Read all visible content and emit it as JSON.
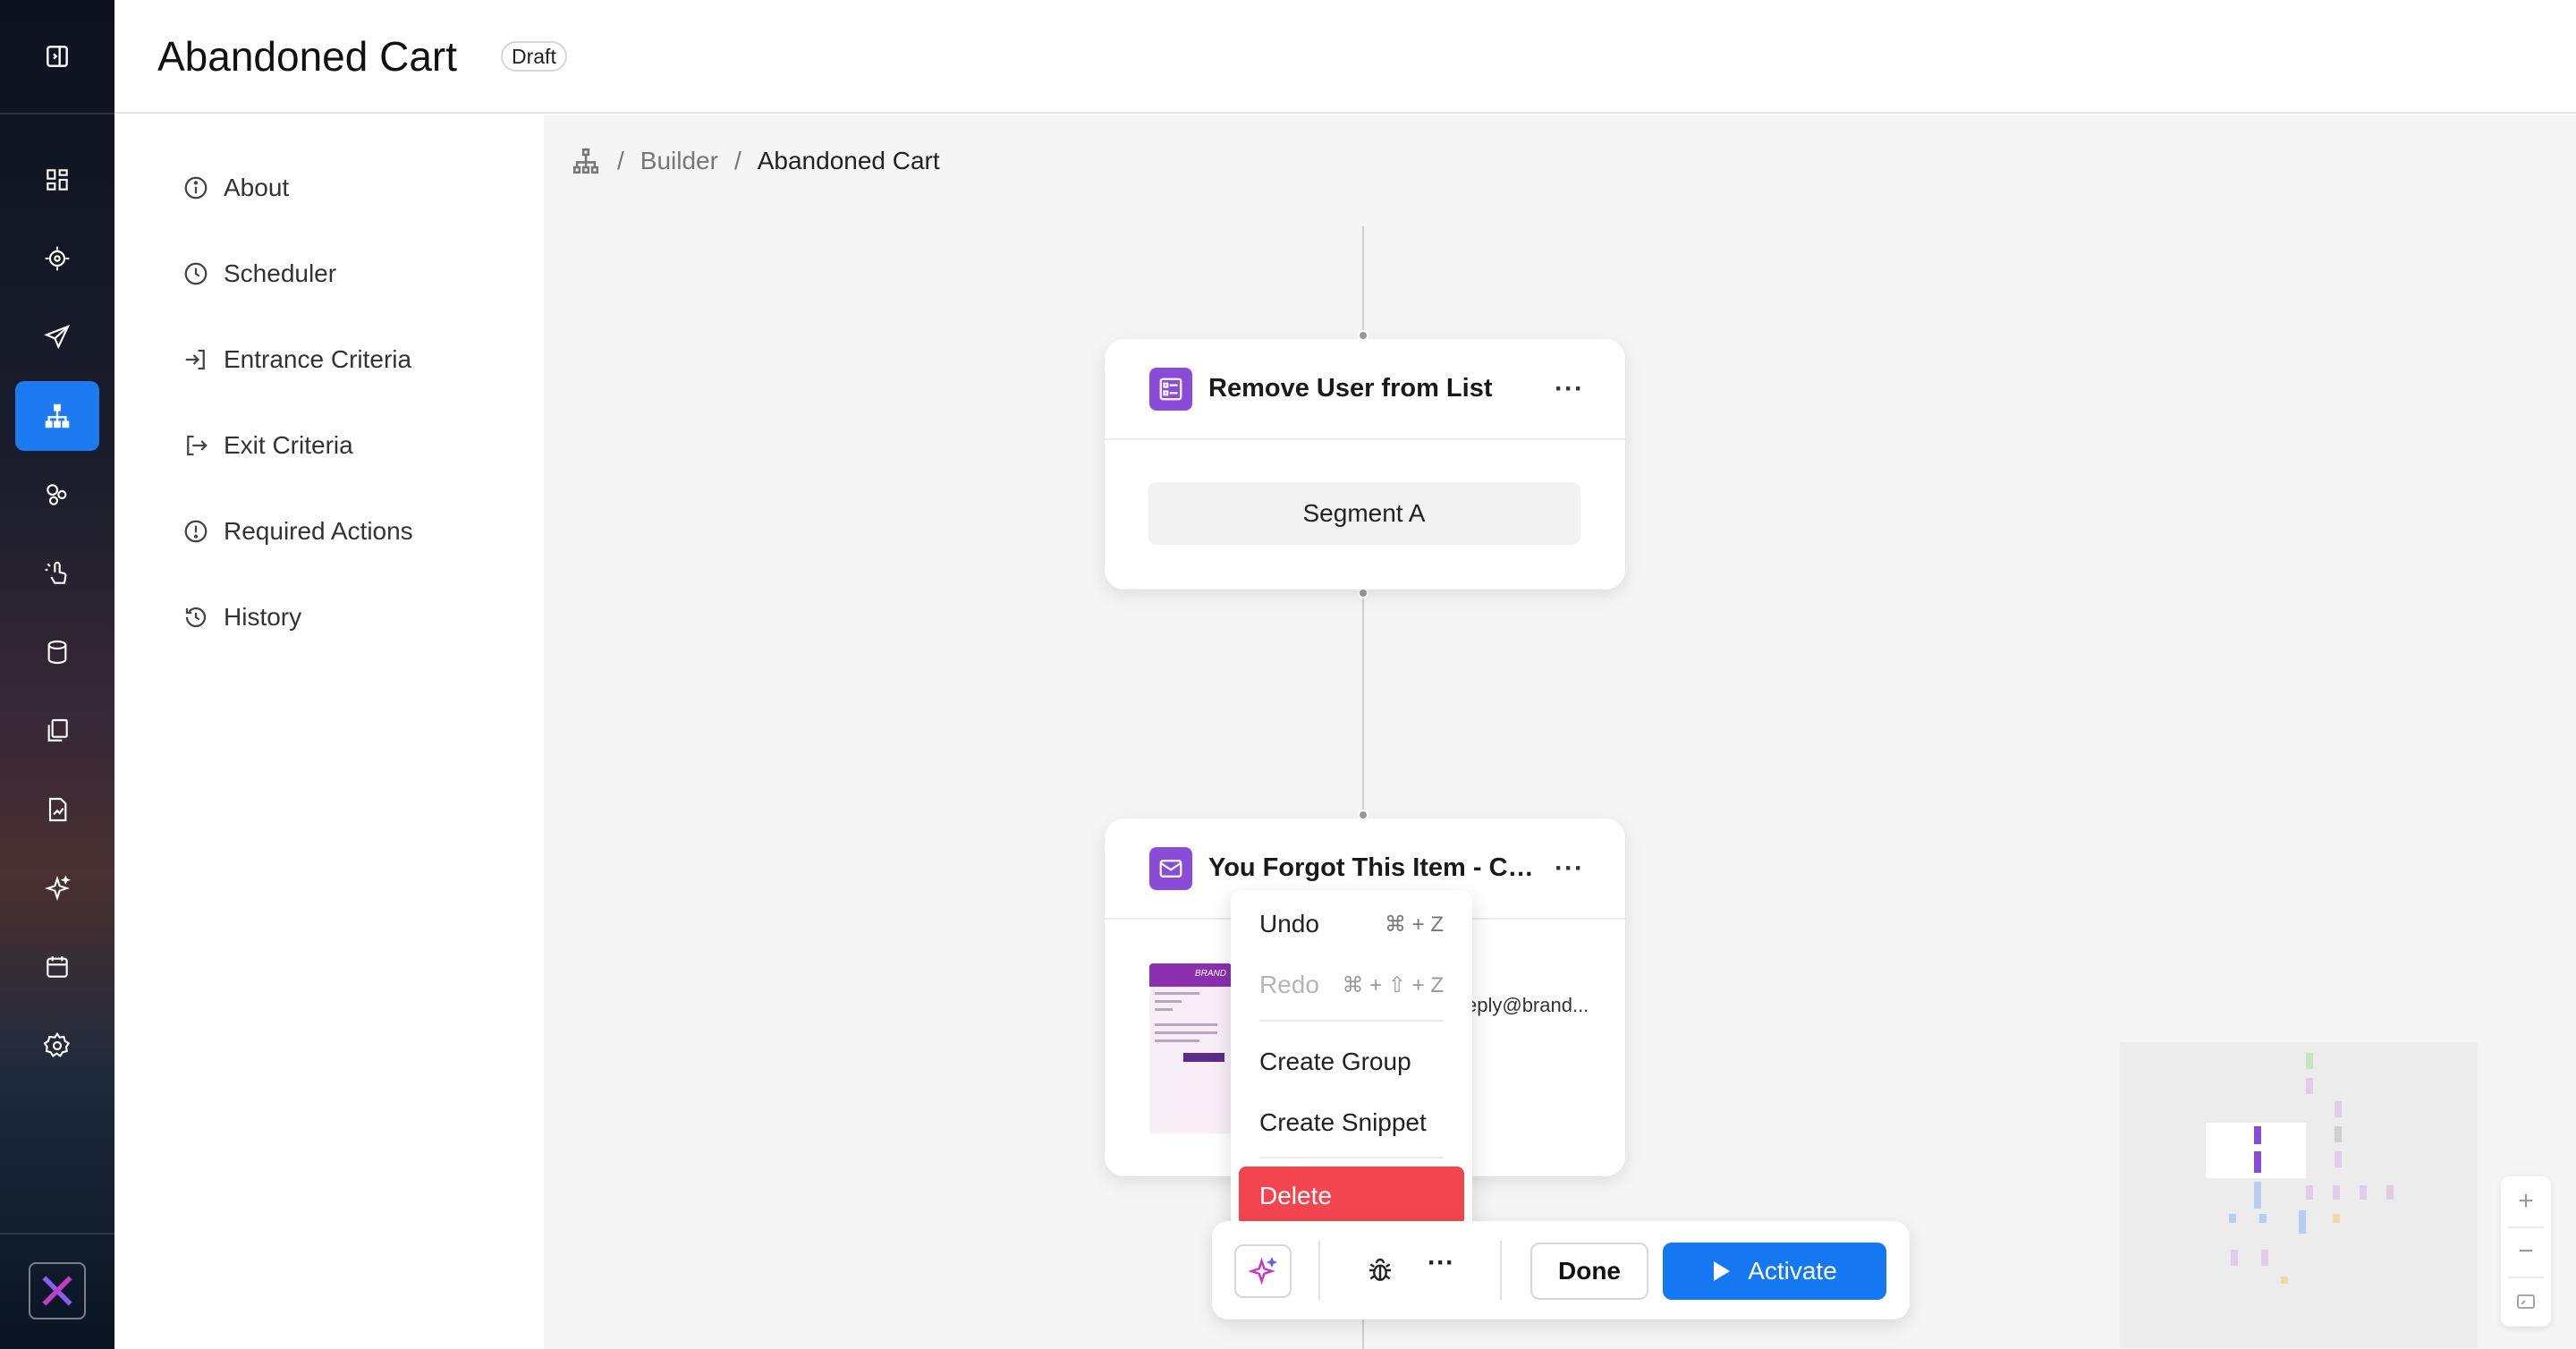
{
  "header": {
    "title": "Abandoned Cart",
    "status_badge": "Draft"
  },
  "rail": {
    "items": [
      {
        "icon": "sidebar-toggle-icon"
      },
      {
        "icon": "dashboard-icon"
      },
      {
        "icon": "target-icon"
      },
      {
        "icon": "send-icon"
      },
      {
        "icon": "journey-icon",
        "active": true
      },
      {
        "icon": "segments-icon"
      },
      {
        "icon": "tap-icon"
      },
      {
        "icon": "database-icon"
      },
      {
        "icon": "templates-icon"
      },
      {
        "icon": "reports-icon"
      },
      {
        "icon": "ai-sparkle-icon"
      },
      {
        "icon": "calendar-icon"
      },
      {
        "icon": "settings-icon"
      }
    ],
    "accent": "#1e7af0"
  },
  "panel": {
    "items": [
      {
        "label": "About",
        "icon": "info-icon"
      },
      {
        "label": "Scheduler",
        "icon": "clock-icon"
      },
      {
        "label": "Entrance Criteria",
        "icon": "enter-icon"
      },
      {
        "label": "Exit Criteria",
        "icon": "exit-icon"
      },
      {
        "label": "Required Actions",
        "icon": "alert-icon"
      },
      {
        "label": "History",
        "icon": "history-icon"
      }
    ]
  },
  "breadcrumb": {
    "root_icon": "hierarchy-icon",
    "sep": "/",
    "items": [
      "Builder",
      "Abandoned Cart"
    ]
  },
  "nodes": [
    {
      "title": "Remove User from List",
      "icon": "list-icon",
      "more": "···",
      "segment": "Segment A"
    },
    {
      "title": "You Forgot This Item - Con...",
      "icon": "mail-icon",
      "more": "···",
      "from_text": "eply@brand...",
      "thumbnail_brand": "BRAND"
    }
  ],
  "context_menu": {
    "items": [
      {
        "label": "Undo",
        "shortcut": "⌘ + Z",
        "disabled": false
      },
      {
        "label": "Redo",
        "shortcut": "⌘ + ⇧ + Z",
        "disabled": true
      },
      {
        "label": "Create Group"
      },
      {
        "label": "Create Snippet"
      },
      {
        "label": "Delete",
        "danger": true
      }
    ],
    "danger_color": "#f2454f"
  },
  "toolbar": {
    "done_label": "Done",
    "activate_label": "Activate",
    "more": "···",
    "primary_color": "#1677f2"
  },
  "zoom": {
    "in": "+",
    "out": "−"
  }
}
